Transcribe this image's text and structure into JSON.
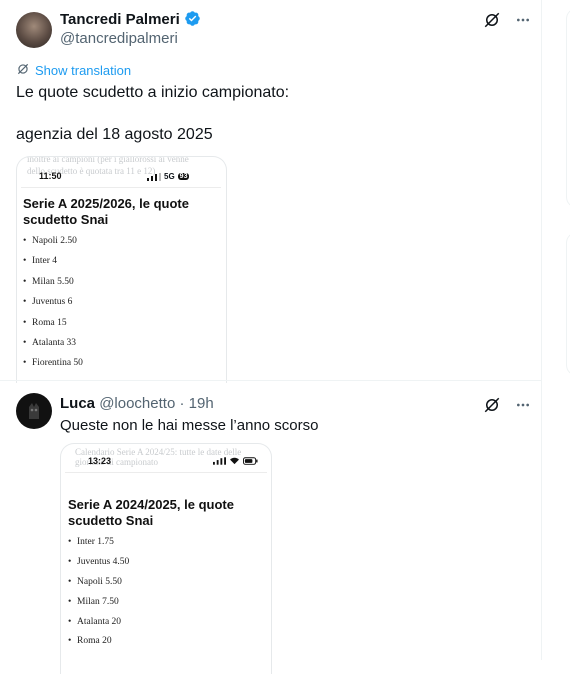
{
  "tweet1": {
    "author_name": "Tancredi Palmeri",
    "author_handle": "@tancredipalmeri",
    "show_translation": "Show translation",
    "text": "Le quote scudetto a inizio campionato:\n\nagenzia del 18 agosto 2025",
    "image": {
      "ghost_line_1": "inoltre ai campioni (per i giallorossi ai venne",
      "ghost_line_2": "dello scudetto è quotata tra 11 e 12)",
      "time": "11:50",
      "network": "5G",
      "battery": "93",
      "title": "Serie A 2025/2026, le quote scudetto Snai",
      "items": [
        "Napoli 2.50",
        "Inter 4",
        "Milan 5.50",
        "Juventus 6",
        "Roma 15",
        "Atalanta 33",
        "Fiorentina 50"
      ]
    }
  },
  "tweet2": {
    "author_name": "Luca",
    "author_handle": "@loochetto",
    "time_ago": "· 19h",
    "text": "Queste non le hai messe l’anno scorso",
    "image": {
      "ghost_line_1": "Calendario Serie A 2024/25: tutte le date delle",
      "ghost_line_2": "giornate di campionato",
      "time": "13:23",
      "title": "Serie A 2024/2025, le quote scudetto Snai",
      "items": [
        "Inter 1.75",
        "Juventus 4.50",
        "Napoli 5.50",
        "Milan 7.50",
        "Atalanta 20",
        "Roma 20"
      ]
    }
  },
  "colors": {
    "accent": "#1d9bf0",
    "text": "#0f1419",
    "muted": "#536471"
  }
}
